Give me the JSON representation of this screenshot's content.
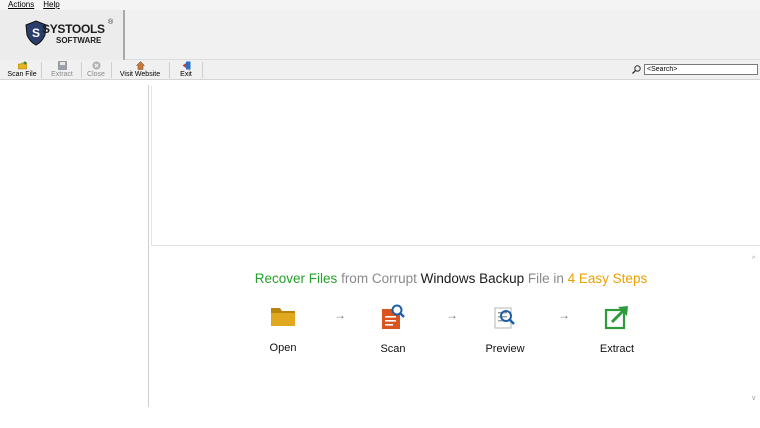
{
  "menu": {
    "actions": "Actions",
    "help": "Help"
  },
  "brand": {
    "name": "SYSTOOLS",
    "sub": "SOFTWARE",
    "reg": "®"
  },
  "toolbar": {
    "scan_file": "Scan File",
    "extract": "Extract",
    "close": "Close",
    "visit_website": "Visit Website",
    "exit": "Exit"
  },
  "search": {
    "placeholder": "<Search>"
  },
  "steps_panel": {
    "headline": {
      "part1": "Recover Files",
      "part2": " from Corrupt ",
      "part3": "Windows Backup",
      "part4": " File in ",
      "part5": "4 Easy Steps"
    },
    "steps": [
      {
        "label": "Open",
        "icon": "folder-icon"
      },
      {
        "label": "Scan",
        "icon": "scan-document-icon"
      },
      {
        "label": "Preview",
        "icon": "preview-icon"
      },
      {
        "label": "Extract",
        "icon": "extract-icon"
      }
    ],
    "arrow": "→"
  },
  "colors": {
    "green": "#25a02a",
    "orange": "#e8a200",
    "blue": "#1f5fa8"
  }
}
